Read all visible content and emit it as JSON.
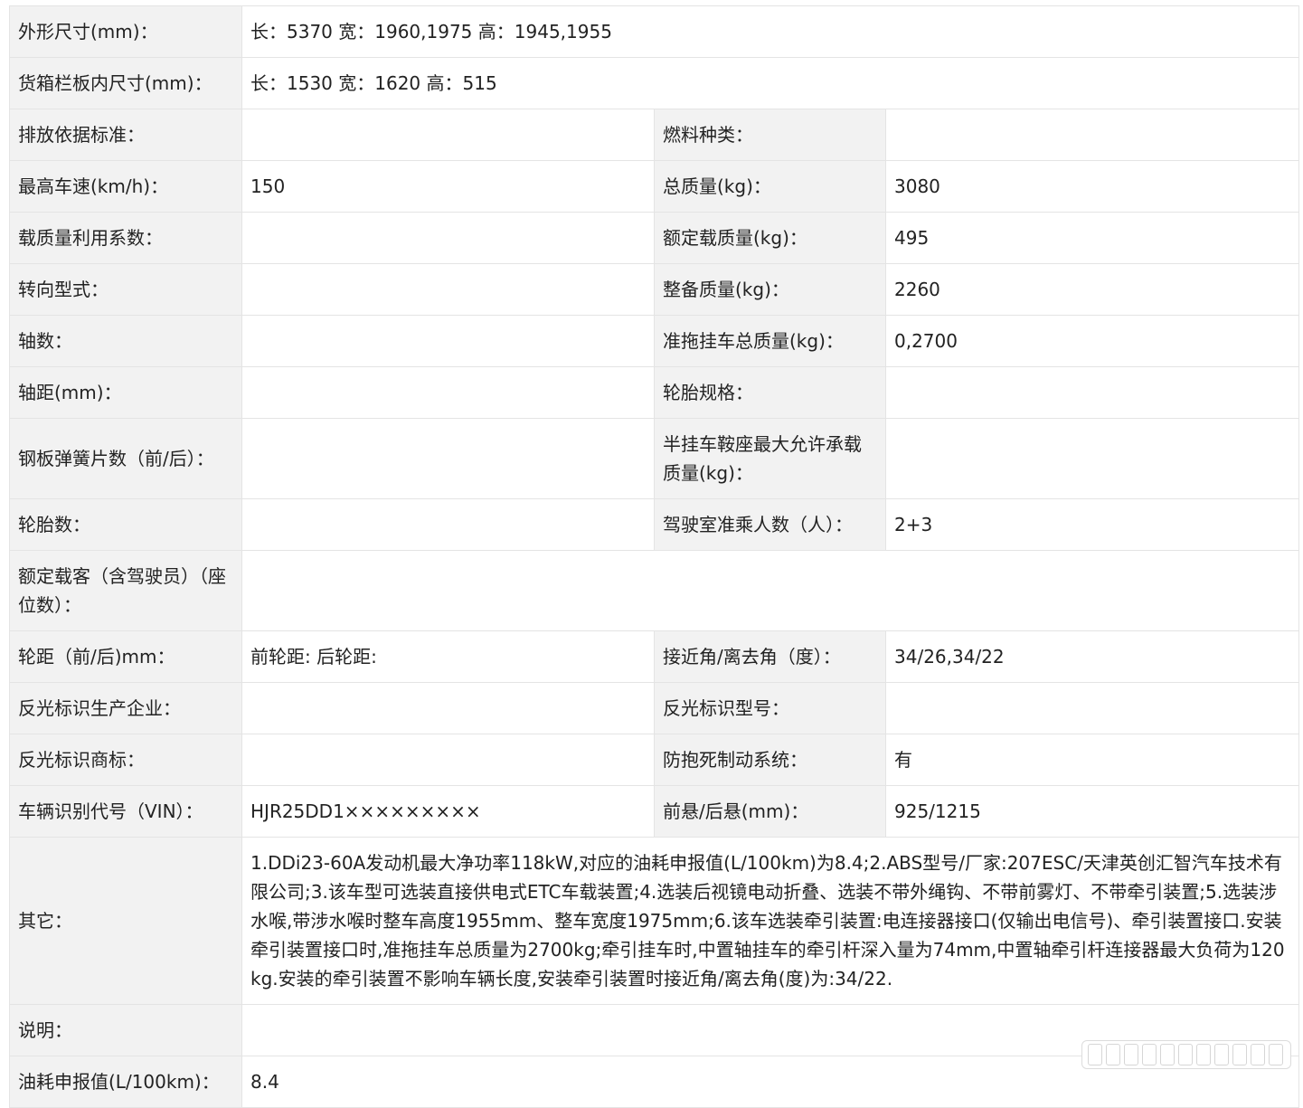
{
  "rows": {
    "r1": {
      "label": "外形尺寸(mm)：",
      "value": "长：5370 宽：1960,1975 高：1945,1955"
    },
    "r2": {
      "label": "货箱栏板内尺寸(mm)：",
      "value": "长：1530 宽：1620 高：515"
    },
    "r3": {
      "label1": "排放依据标准：",
      "value1": "",
      "label2": "燃料种类：",
      "value2": ""
    },
    "r4": {
      "label1": "最高车速(km/h)：",
      "value1": "150",
      "label2": "总质量(kg)：",
      "value2": "3080"
    },
    "r5": {
      "label1": "载质量利用系数：",
      "value1": "",
      "label2": "额定载质量(kg)：",
      "value2": "495"
    },
    "r6": {
      "label1": "转向型式：",
      "value1": "",
      "label2": "整备质量(kg)：",
      "value2": "2260"
    },
    "r7": {
      "label1": "轴数：",
      "value1": "",
      "label2": "准拖挂车总质量(kg)：",
      "value2": "0,2700"
    },
    "r8": {
      "label1": "轴距(mm)：",
      "value1": "",
      "label2": "轮胎规格：",
      "value2": ""
    },
    "r9": {
      "label1": "钢板弹簧片数（前/后）：",
      "value1": "",
      "label2": "半挂车鞍座最大允许承载质量(kg)：",
      "value2": ""
    },
    "r10": {
      "label1": "轮胎数：",
      "value1": "",
      "label2": "驾驶室准乘人数（人）：",
      "value2": "2+3"
    },
    "r11": {
      "label": "额定载客（含驾驶员）（座位数）：",
      "value": ""
    },
    "r12": {
      "label1": "轮距（前/后)mm：",
      "value1": "前轮距: 后轮距:",
      "label2": "接近角/离去角（度）：",
      "value2": "34/26,34/22"
    },
    "r13": {
      "label1": "反光标识生产企业：",
      "value1": "",
      "label2": "反光标识型号：",
      "value2": ""
    },
    "r14": {
      "label1": "反光标识商标：",
      "value1": "",
      "label2": "防抱死制动系统：",
      "value2": "有"
    },
    "r15": {
      "label1": "车辆识别代号（VIN）：",
      "value1": "HJR25DD1×××××××××",
      "label2": "前悬/后悬(mm)：",
      "value2": "925/1215"
    },
    "r16": {
      "label": "其它：",
      "value": "1.DDi23-60A发动机最大净功率118kW,对应的油耗申报值(L/100km)为8.4;2.ABS型号/厂家:207ESC/天津英创汇智汽车技术有限公司;3.该车型可选装直接供电式ETC车载装置;4.选装后视镜电动折叠、选装不带外绳钩、不带前雾灯、不带牵引装置;5.选装涉水喉,带涉水喉时整车高度1955mm、整车宽度1975mm;6.该车选装牵引装置:电连接器接口(仅输出电信号)、牵引装置接口.安装牵引装置接口时,准拖挂车总质量为2700kg;牵引挂车时,中置轴挂车的牵引杆深入量为74mm,中置轴牵引杆连接器最大负荷为120kg.安装的牵引装置不影响车辆长度,安装牵引装置时接近角/离去角(度)为:34/22."
    },
    "r17": {
      "label": "说明：",
      "value": ""
    },
    "r18": {
      "label": "油耗申报值(L/100km)：",
      "value": "8.4"
    }
  },
  "colors": {
    "label_bg": "#f2f2f2",
    "value_bg": "#ffffff",
    "border": "#e4e4e4",
    "text": "#222222"
  }
}
